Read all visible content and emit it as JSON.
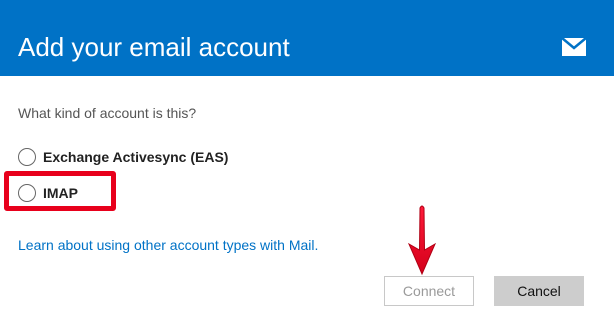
{
  "dialog": {
    "title": "Add your email account",
    "header_icon": "mail-icon",
    "header_color": "#0072c6"
  },
  "question": "What kind of account is this?",
  "account_types": [
    {
      "label": "Exchange Activesync (EAS)",
      "selected": false
    },
    {
      "label": "IMAP",
      "selected": false
    }
  ],
  "learn_link": "Learn about using other account types with Mail.",
  "buttons": {
    "connect_label": "Connect",
    "connect_enabled": false,
    "cancel_label": "Cancel"
  },
  "annotations": {
    "highlight_color": "#e8001c",
    "arrow_icon": "arrow-down-icon"
  }
}
